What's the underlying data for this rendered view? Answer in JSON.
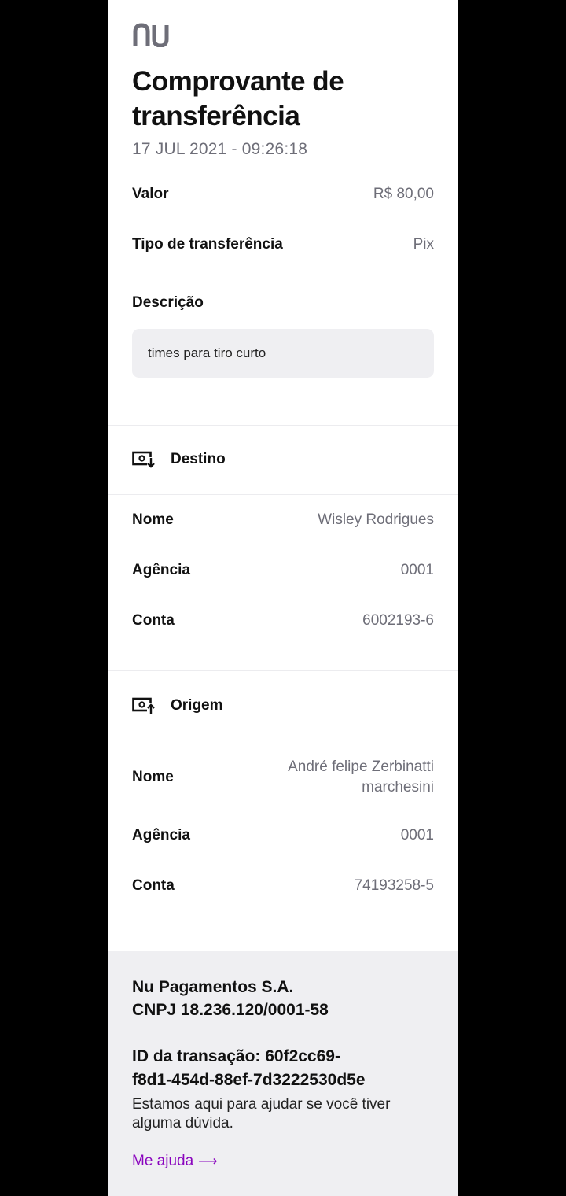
{
  "brand": {
    "logo_text": "nu",
    "logo_color": "#6e6e78",
    "accent_color": "#8a05be"
  },
  "header": {
    "title": "Comprovante de transferência",
    "date": "17 JUL 2021 - 09:26:18"
  },
  "summary": {
    "valor_label": "Valor",
    "valor_value": "R$ 80,00",
    "tipo_label": "Tipo de transferência",
    "tipo_value": "Pix",
    "descricao_label": "Descrição",
    "descricao_value": "times para tiro curto"
  },
  "destino": {
    "section_title": "Destino",
    "icon": "money-in-icon",
    "nome_label": "Nome",
    "nome_value": "Wisley Rodrigues",
    "agencia_label": "Agência",
    "agencia_value": "0001",
    "conta_label": "Conta",
    "conta_value": "6002193-6"
  },
  "origem": {
    "section_title": "Origem",
    "icon": "money-out-icon",
    "nome_label": "Nome",
    "nome_value_line1": "André felipe Zerbinatti",
    "nome_value_line2": "marchesini",
    "agencia_label": "Agência",
    "agencia_value": "0001",
    "conta_label": "Conta",
    "conta_value": "74193258-5"
  },
  "footer": {
    "company": "Nu Pagamentos S.A.",
    "cnpj": "CNPJ 18.236.120/0001-58",
    "transaction_id_line1": "ID da transação: 60f2cc69-",
    "transaction_id_line2": "f8d1-454d-88ef-7d3222530d5e",
    "help_text": "Estamos aqui para ajudar se você tiver alguma dúvida.",
    "help_link": "Me ajuda",
    "help_arrow": "⟶"
  }
}
